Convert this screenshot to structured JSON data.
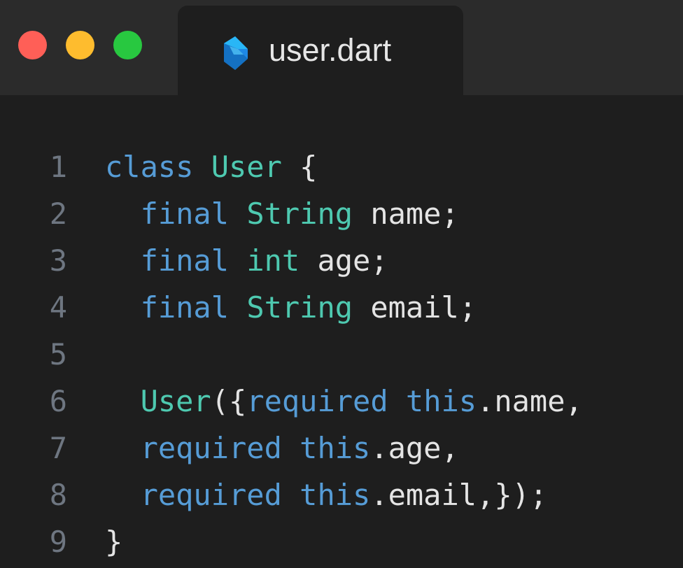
{
  "window": {
    "controls": {
      "close_color": "#ff5f57",
      "minimize_color": "#febc2e",
      "maximize_color": "#28c840"
    }
  },
  "tab": {
    "label": "user.dart",
    "icon": "dart-logo-icon"
  },
  "theme": {
    "keyword_color": "#569cd6",
    "type_color": "#4ec9b0",
    "text_color": "#e4e4e4",
    "line_number_color": "#6e7681"
  },
  "code": {
    "lines": [
      {
        "number": "1",
        "tokens": [
          {
            "t": "class",
            "k": "kw"
          },
          {
            "t": " ",
            "k": "pn"
          },
          {
            "t": "User",
            "k": "ty"
          },
          {
            "t": " {",
            "k": "pn"
          }
        ]
      },
      {
        "number": "2",
        "tokens": [
          {
            "t": "  ",
            "k": "pn"
          },
          {
            "t": "final",
            "k": "kw"
          },
          {
            "t": " ",
            "k": "pn"
          },
          {
            "t": "String",
            "k": "ty"
          },
          {
            "t": " name;",
            "k": "id"
          }
        ]
      },
      {
        "number": "3",
        "tokens": [
          {
            "t": "  ",
            "k": "pn"
          },
          {
            "t": "final",
            "k": "kw"
          },
          {
            "t": " ",
            "k": "pn"
          },
          {
            "t": "int",
            "k": "ty"
          },
          {
            "t": " age;",
            "k": "id"
          }
        ]
      },
      {
        "number": "4",
        "tokens": [
          {
            "t": "  ",
            "k": "pn"
          },
          {
            "t": "final",
            "k": "kw"
          },
          {
            "t": " ",
            "k": "pn"
          },
          {
            "t": "String",
            "k": "ty"
          },
          {
            "t": " email;",
            "k": "id"
          }
        ]
      },
      {
        "number": "5",
        "tokens": []
      },
      {
        "number": "6",
        "tokens": [
          {
            "t": "  ",
            "k": "pn"
          },
          {
            "t": "User",
            "k": "ty"
          },
          {
            "t": "({",
            "k": "pn"
          },
          {
            "t": "required",
            "k": "kw"
          },
          {
            "t": " ",
            "k": "pn"
          },
          {
            "t": "this",
            "k": "kw"
          },
          {
            "t": ".name,",
            "k": "id"
          }
        ]
      },
      {
        "number": "7",
        "tokens": [
          {
            "t": "  ",
            "k": "pn"
          },
          {
            "t": "required",
            "k": "kw"
          },
          {
            "t": " ",
            "k": "pn"
          },
          {
            "t": "this",
            "k": "kw"
          },
          {
            "t": ".age,",
            "k": "id"
          }
        ]
      },
      {
        "number": "8",
        "tokens": [
          {
            "t": "  ",
            "k": "pn"
          },
          {
            "t": "required",
            "k": "kw"
          },
          {
            "t": " ",
            "k": "pn"
          },
          {
            "t": "this",
            "k": "kw"
          },
          {
            "t": ".email,});",
            "k": "id"
          }
        ]
      },
      {
        "number": "9",
        "tokens": [
          {
            "t": "}",
            "k": "pn"
          }
        ]
      }
    ]
  }
}
